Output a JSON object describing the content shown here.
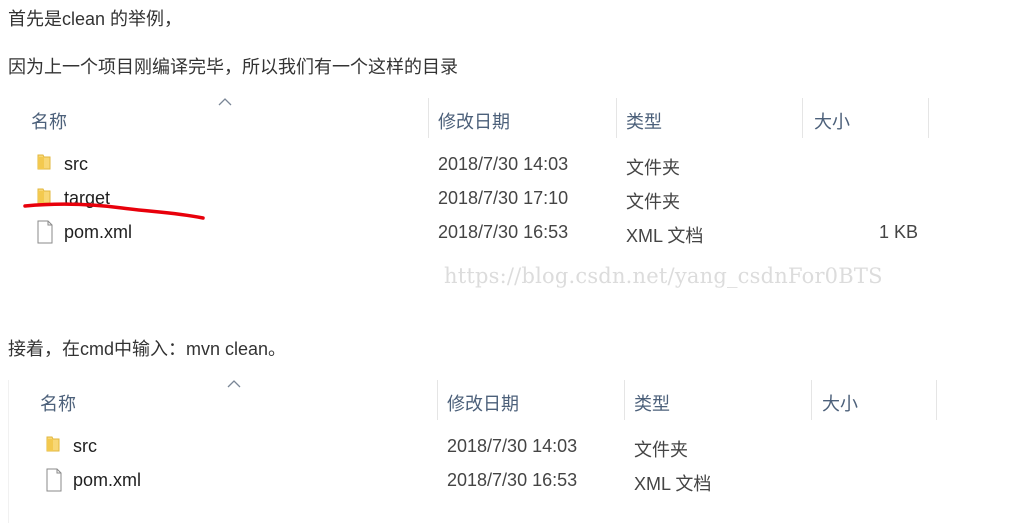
{
  "paragraphs": {
    "intro": "首先是clean 的举例，",
    "before": "因为上一个项目刚编译完毕，所以我们有一个这样的目录",
    "after": "接着，在cmd中输入：mvn clean。"
  },
  "columns": {
    "name": "名称",
    "modified": "修改日期",
    "type": "类型",
    "size": "大小"
  },
  "explorer_before": {
    "rows": [
      {
        "name": "src",
        "modified": "2018/7/30 14:03",
        "type": "文件夹",
        "size": "",
        "icon": "folder-icon"
      },
      {
        "name": "target",
        "modified": "2018/7/30 17:10",
        "type": "文件夹",
        "size": "",
        "icon": "folder-icon"
      },
      {
        "name": "pom.xml",
        "modified": "2018/7/30 16:53",
        "type": "XML 文档",
        "size": "1 KB",
        "icon": "file-icon"
      }
    ]
  },
  "explorer_after": {
    "rows": [
      {
        "name": "src",
        "modified": "2018/7/30 14:03",
        "type": "文件夹",
        "icon": "folder-icon"
      },
      {
        "name": "pom.xml",
        "modified": "2018/7/30 16:53",
        "type": "XML 文档",
        "icon": "file-icon"
      }
    ]
  },
  "watermark": "https://blog.csdn.net/yang_csdnFor0BTS",
  "colors": {
    "folder": "#f8d775",
    "annotation": "#e8000b",
    "header_text": "#4c607a"
  }
}
